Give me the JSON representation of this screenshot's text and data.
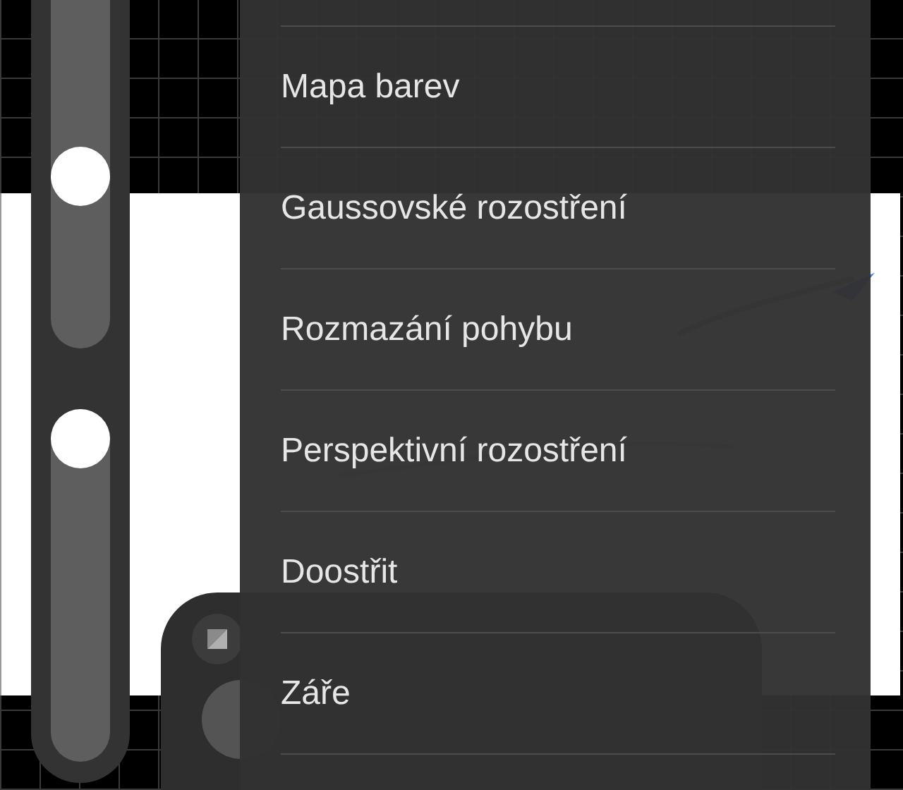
{
  "sliders": [
    {
      "kind": "size",
      "level": 0.38
    },
    {
      "kind": "opacity",
      "level": 1
    }
  ],
  "menu": {
    "items": [
      {
        "label": "Mapa barev"
      },
      {
        "label": "Gaussovské rozostření"
      },
      {
        "label": "Rozmazání pohybu"
      },
      {
        "label": "Perspektivní rozostření"
      },
      {
        "label": "Doostřit"
      },
      {
        "label": "Záře"
      }
    ]
  }
}
